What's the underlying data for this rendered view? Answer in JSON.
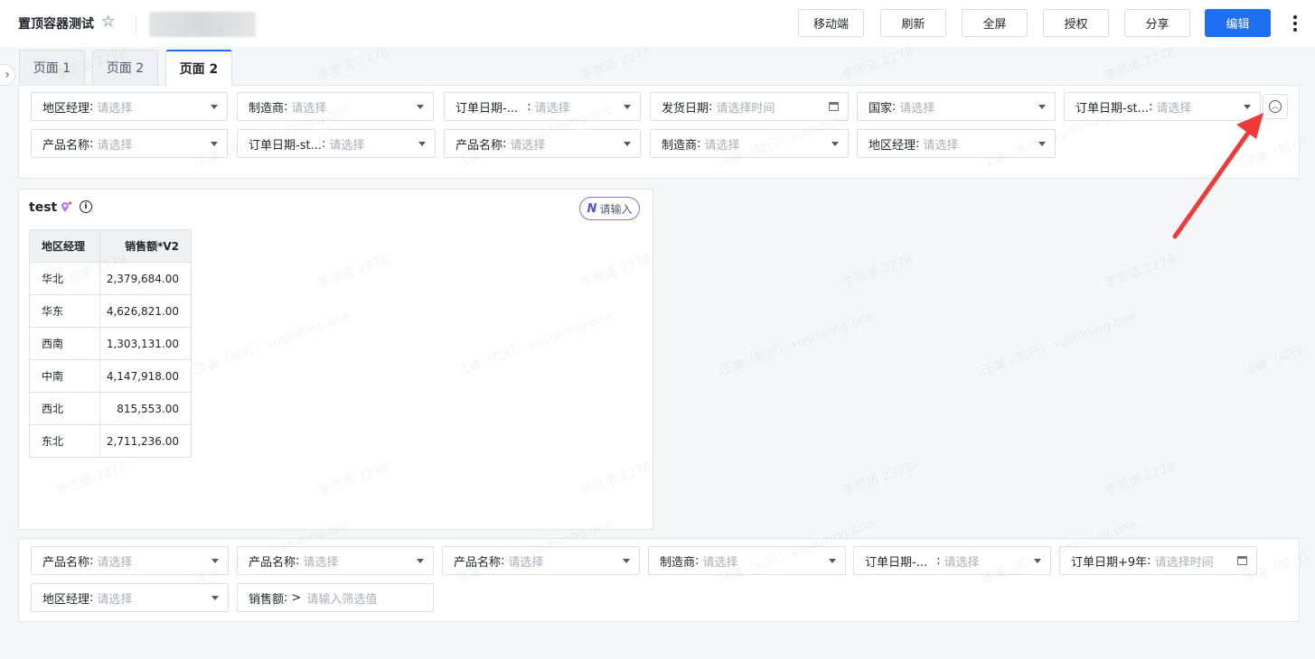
{
  "header": {
    "title": "置顶容器测试",
    "buttons": {
      "mobile": "移动端",
      "refresh": "刷新",
      "fullscreen": "全屏",
      "authorize": "授权",
      "share": "分享",
      "edit": "编辑"
    }
  },
  "tabs": [
    {
      "label": "页面 1",
      "active": false
    },
    {
      "label": "页面 2",
      "active": false
    },
    {
      "label": "页面 2",
      "active": true
    }
  ],
  "top_filters": [
    {
      "label": "地区经理",
      "placeholder": "请选择",
      "icon": "caret-down"
    },
    {
      "label": "制造商",
      "placeholder": "请选择",
      "icon": "caret-down"
    },
    {
      "label": "订单日期-...",
      "placeholder": "请选择",
      "icon": "caret-down"
    },
    {
      "label": "发货日期",
      "placeholder": "请选择时间",
      "icon": "calendar"
    },
    {
      "label": "国家",
      "placeholder": "请选择",
      "icon": "caret-down"
    },
    {
      "label": "订单日期-st...",
      "placeholder": "请选择",
      "icon": "caret-down"
    },
    {
      "label": "产品名称",
      "placeholder": "请选择",
      "icon": "caret-down"
    },
    {
      "label": "订单日期-st...",
      "placeholder": "请选择",
      "icon": "caret-down"
    },
    {
      "label": "产品名称",
      "placeholder": "请选择",
      "icon": "caret-down"
    },
    {
      "label": "制造商",
      "placeholder": "请选择",
      "icon": "caret-down"
    },
    {
      "label": "地区经理",
      "placeholder": "请选择",
      "icon": "caret-down"
    }
  ],
  "card": {
    "title": "test",
    "ai_button": "请输入",
    "table": {
      "headers": [
        "地区经理",
        "销售额*V2"
      ],
      "rows": [
        [
          "华北",
          "2,379,684.00"
        ],
        [
          "华东",
          "4,626,821.00"
        ],
        [
          "西南",
          "1,303,131.00"
        ],
        [
          "中南",
          "4,147,918.00"
        ],
        [
          "西北",
          "815,553.00"
        ],
        [
          "东北",
          "2,711,236.00"
        ]
      ]
    }
  },
  "bottom_filters": [
    {
      "label": "产品名称",
      "placeholder": "请选择",
      "icon": "caret-down"
    },
    {
      "label": "产品名称",
      "placeholder": "请选择",
      "icon": "caret-down"
    },
    {
      "label": "产品名称",
      "placeholder": "请选择",
      "icon": "caret-down"
    },
    {
      "label": "制造商",
      "placeholder": "请选择",
      "icon": "caret-down"
    },
    {
      "label": "订单日期-...",
      "placeholder": "请选择",
      "icon": "caret-down"
    },
    {
      "label": "订单日期+9年",
      "placeholder": "请选择时间",
      "icon": "calendar"
    },
    {
      "label": "地区经理",
      "placeholder": "请选择",
      "icon": "caret-down"
    },
    {
      "label": "销售额",
      "operator": ">",
      "placeholder": "请输入筛选值",
      "icon": "none"
    }
  ],
  "watermark": {
    "name": "李思诺 2278",
    "alt": "汪谦（知行）xushining.one"
  },
  "colors": {
    "primary": "#1e6ff0",
    "arrow": "#f03a3a",
    "ai_border": "#8a6cf0"
  }
}
